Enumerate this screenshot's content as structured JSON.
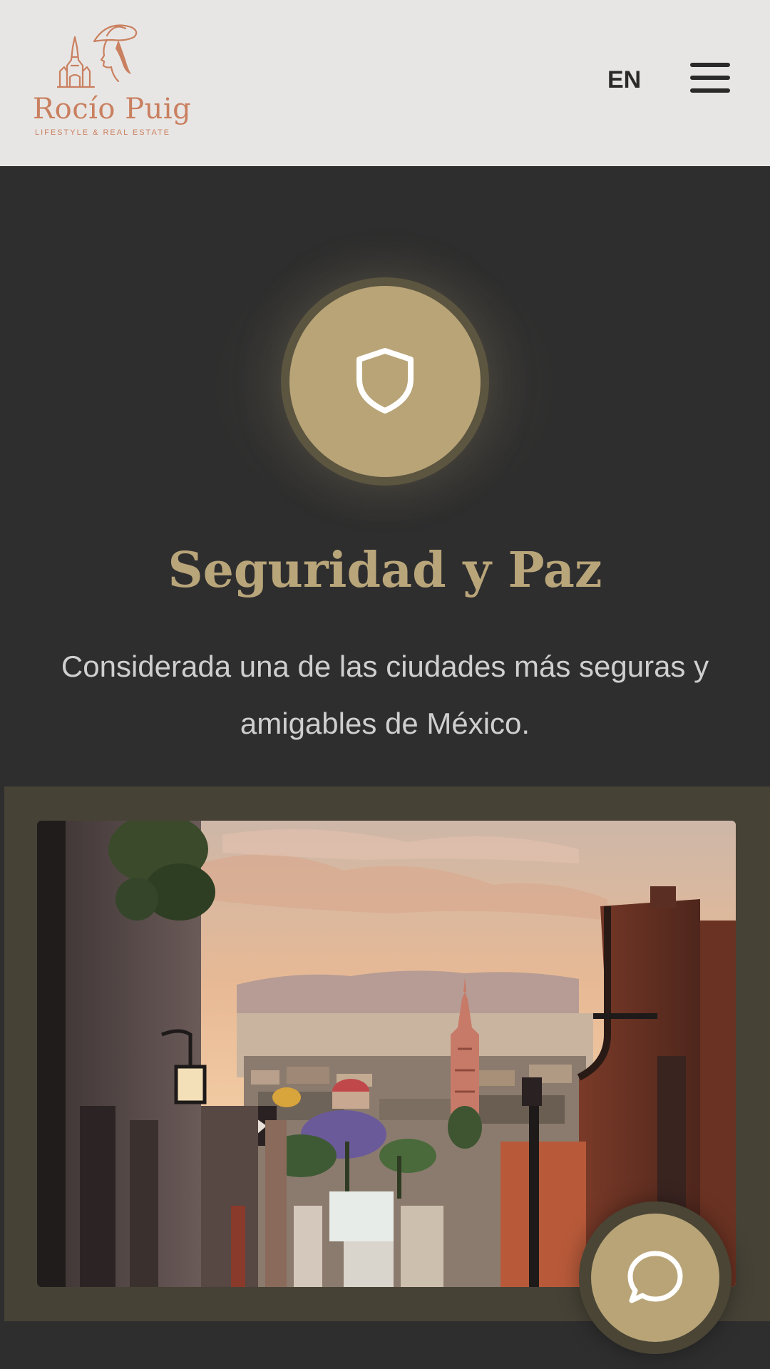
{
  "header": {
    "logo_name": "Rocío Puig",
    "logo_tagline": "LIFESTYLE & REAL ESTATE",
    "language_button": "EN",
    "menu_icon": "hamburger-menu-icon"
  },
  "feature": {
    "icon": "shield-icon",
    "title": "Seguridad y Paz",
    "description": "Considerada una de las ciudades más seguras y amigables de México."
  },
  "chat": {
    "icon": "chat-bubble-icon"
  },
  "colors": {
    "header_bg": "#e8e6e4",
    "page_bg": "#2e2e2e",
    "accent_gold": "#b8a477",
    "title_gold": "#b9a57a",
    "logo_terracotta": "#c98060",
    "band_bg": "#464236"
  }
}
